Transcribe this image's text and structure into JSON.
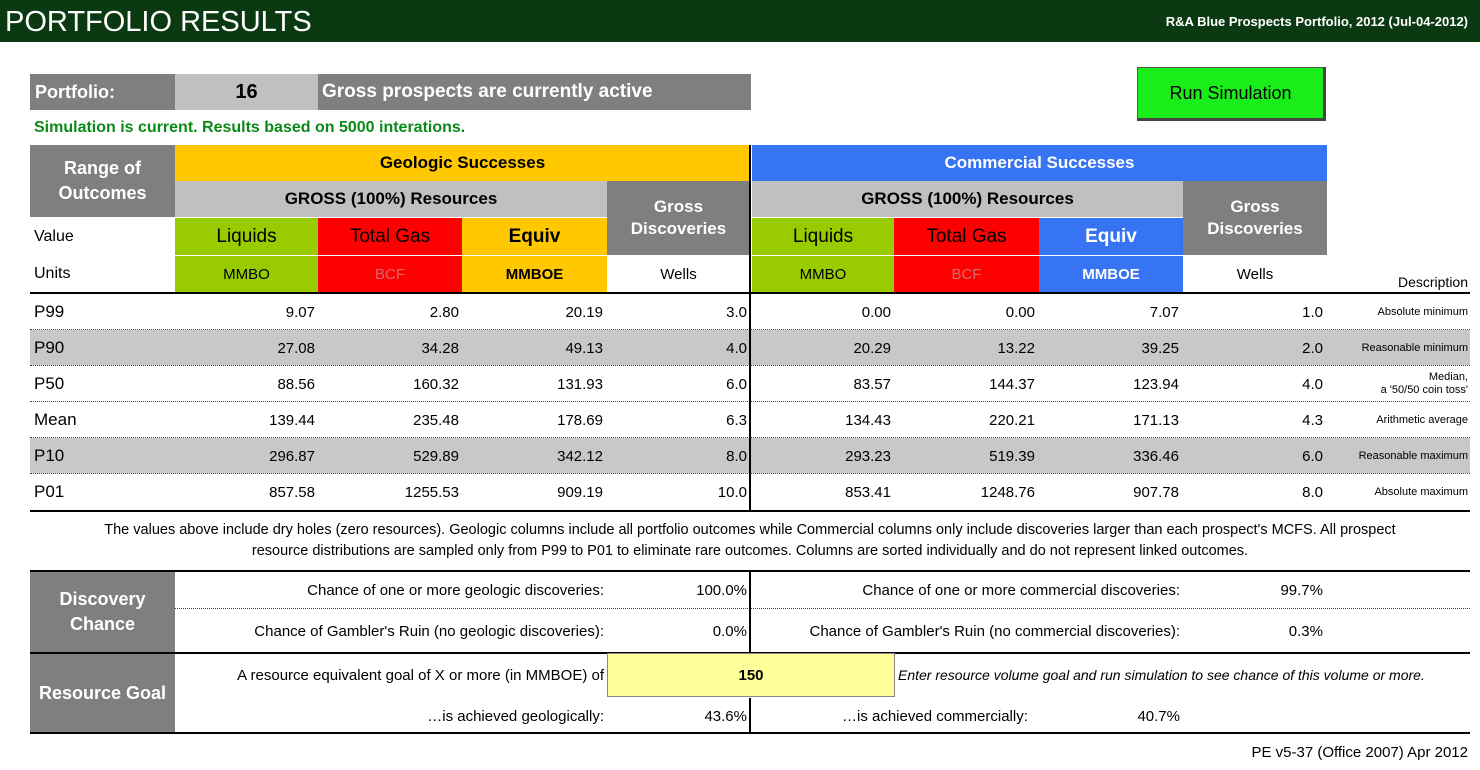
{
  "header": {
    "title": "PORTFOLIO RESULTS",
    "portfolio_name": "R&A Blue Prospects Portfolio, 2012 (Jul-04-2012)"
  },
  "portfolio": {
    "label": "Portfolio:",
    "count": "16",
    "description": "Gross prospects are currently active"
  },
  "run_button": "Run Simulation",
  "sim_status": "Simulation is current. Results based on 5000 interations.",
  "headers": {
    "range_of_outcomes": "Range of Outcomes",
    "geologic": "Geologic Successes",
    "commercial": "Commercial Successes",
    "gross_resources": "GROSS (100%) Resources",
    "gross_discoveries": "Gross Discoveries",
    "value": "Value",
    "units": "Units",
    "description": "Description",
    "liquids": "Liquids",
    "total_gas": "Total Gas",
    "equiv": "Equiv",
    "mmbo": "MMBO",
    "bcf": "BCF",
    "mmboe": "MMBOE",
    "wells": "Wells"
  },
  "rows": [
    {
      "label": "P99",
      "g_liq": "9.07",
      "g_gas": "2.80",
      "g_eqv": "20.19",
      "g_wells": "3.0",
      "c_liq": "0.00",
      "c_gas": "0.00",
      "c_eqv": "7.07",
      "c_wells": "1.0",
      "desc1": "Absolute minimum",
      "desc2": ""
    },
    {
      "label": "P90",
      "g_liq": "27.08",
      "g_gas": "34.28",
      "g_eqv": "49.13",
      "g_wells": "4.0",
      "c_liq": "20.29",
      "c_gas": "13.22",
      "c_eqv": "39.25",
      "c_wells": "2.0",
      "desc1": "Reasonable minimum",
      "desc2": ""
    },
    {
      "label": "P50",
      "g_liq": "88.56",
      "g_gas": "160.32",
      "g_eqv": "131.93",
      "g_wells": "6.0",
      "c_liq": "83.57",
      "c_gas": "144.37",
      "c_eqv": "123.94",
      "c_wells": "4.0",
      "desc1": "Median,",
      "desc2": "a '50/50 coin toss'"
    },
    {
      "label": "Mean",
      "g_liq": "139.44",
      "g_gas": "235.48",
      "g_eqv": "178.69",
      "g_wells": "6.3",
      "c_liq": "134.43",
      "c_gas": "220.21",
      "c_eqv": "171.13",
      "c_wells": "4.3",
      "desc1": "Arithmetic average",
      "desc2": ""
    },
    {
      "label": "P10",
      "g_liq": "296.87",
      "g_gas": "529.89",
      "g_eqv": "342.12",
      "g_wells": "8.0",
      "c_liq": "293.23",
      "c_gas": "519.39",
      "c_eqv": "336.46",
      "c_wells": "6.0",
      "desc1": "Reasonable maximum",
      "desc2": ""
    },
    {
      "label": "P01",
      "g_liq": "857.58",
      "g_gas": "1255.53",
      "g_eqv": "909.19",
      "g_wells": "10.0",
      "c_liq": "853.41",
      "c_gas": "1248.76",
      "c_eqv": "907.78",
      "c_wells": "8.0",
      "desc1": "Absolute maximum",
      "desc2": ""
    }
  ],
  "note_line1": "The values above include dry holes (zero resources). Geologic columns include all portfolio outcomes while Commercial columns only include discoveries larger than each prospect's MCFS. All prospect",
  "note_line2": "resource distributions are sampled only from P99 to P01 to eliminate rare outcomes. Columns are sorted individually and do not represent linked outcomes.",
  "discovery": {
    "label": "Discovery Chance",
    "geo_one_label": "Chance of one or more geologic discoveries:",
    "geo_one_value": "100.0%",
    "com_one_label": "Chance of one or more commercial discoveries:",
    "com_one_value": "99.7%",
    "geo_ruin_label": "Chance of Gambler's Ruin (no geologic discoveries):",
    "geo_ruin_value": "0.0%",
    "com_ruin_label": "Chance of Gambler's Ruin (no commercial discoveries):",
    "com_ruin_value": "0.3%"
  },
  "goal": {
    "label": "Resource Goal",
    "prompt": "A resource equivalent goal of X or more (in MMBOE) of",
    "value": "150",
    "hint": "Enter resource volume goal and run simulation to see chance of this volume or more.",
    "geo_label": "…is achieved geologically:",
    "geo_value": "43.6%",
    "com_label": "…is achieved commercially:",
    "com_value": "40.7%"
  },
  "version": "PE v5-37 (Office 2007) Apr 2012",
  "colors": {
    "title_bg": "#0b3a12",
    "geologic": "#ffc800",
    "commercial": "#3674f4",
    "liquids": "#99cc00",
    "gas": "#ff0000",
    "run_button": "#1aee1a",
    "status_green": "#0b8a17",
    "goal_input": "#ffff99"
  }
}
